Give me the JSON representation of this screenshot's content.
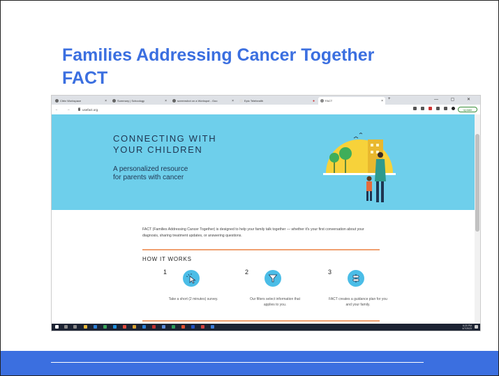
{
  "slide": {
    "title_line1": "Families Addressing Cancer Together",
    "title_line2": "FACT"
  },
  "browser": {
    "tabs": [
      {
        "label": "Citrix Workspace",
        "active": false
      },
      {
        "label": "Summary | Schoology",
        "active": false
      },
      {
        "label": "screenshot on a Workspot - Goo",
        "active": false
      },
      {
        "label": "Epic Telehealth",
        "active": false
      },
      {
        "label": "FACT",
        "active": true
      }
    ],
    "window_controls": "— ▢ ✕",
    "url": "usefact.org",
    "update_label": "Update",
    "nav_glyphs": "← → C"
  },
  "page": {
    "hero_title_line1": "CONNECTING WITH",
    "hero_title_line2": "YOUR CHILDREN",
    "hero_sub_line1": "A personalized resource",
    "hero_sub_line2": "for parents with cancer",
    "intro": "FACT (Families Addressing Cancer Together) is designed to help your family talk together — whether it's your first conversation about your diagnosis, sharing treatment updates, or answering questions.",
    "how_heading": "HOW IT WORKS",
    "steps": [
      {
        "num": "1",
        "icon": "cursor-click-icon",
        "desc": "Take a short (2 minutes) survey."
      },
      {
        "num": "2",
        "icon": "funnel-filter-icon",
        "desc": "Our filters select information that applies to you."
      },
      {
        "num": "3",
        "icon": "signpost-icon",
        "desc": "FACT creates a guidance plan for you and your family."
      }
    ]
  },
  "taskbar": {
    "time": "6:20 PM",
    "date": "4/7/2023"
  },
  "colors": {
    "title_blue": "#3b6fe0",
    "hero_sky": "#6ecfeb",
    "accent_orange": "#f0a070",
    "sun_yellow": "#f7d23a",
    "tree_green": "#3fae5a"
  }
}
